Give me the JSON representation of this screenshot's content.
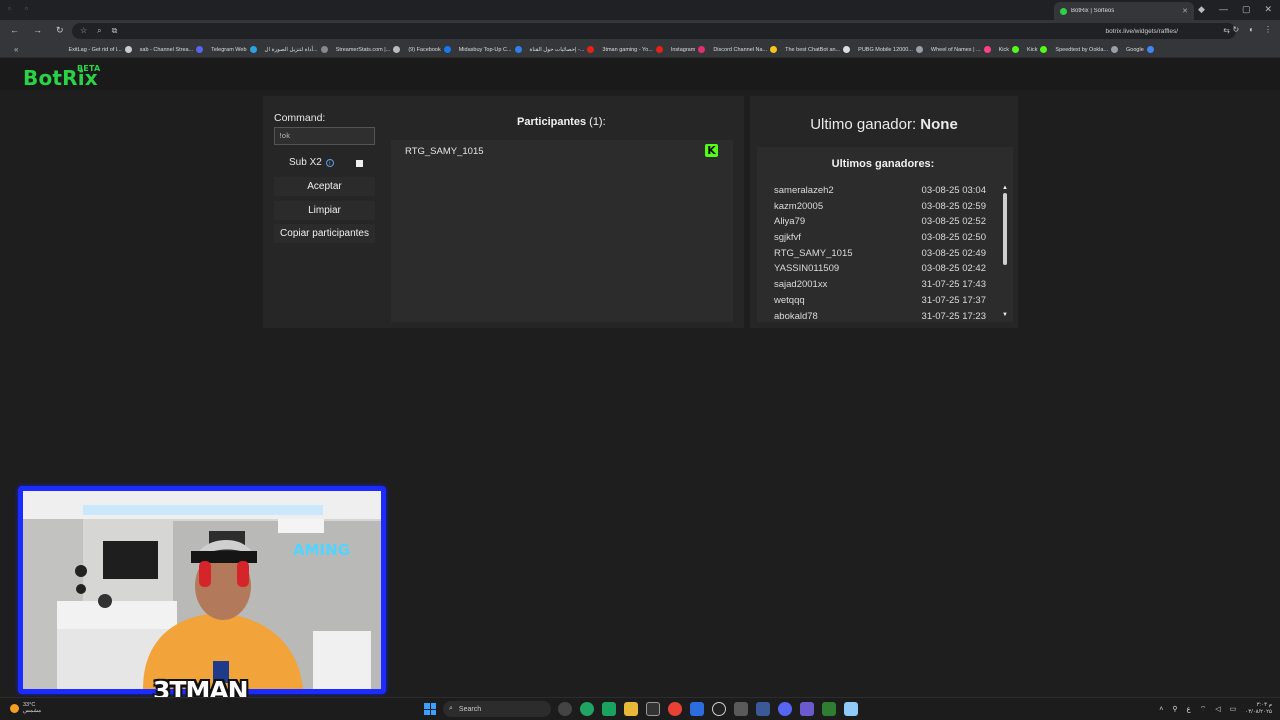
{
  "browser": {
    "tab_title": "BotRix | Sorteos",
    "url": "botrix.live/widgets/raffles/",
    "bookmarks": [
      {
        "label": "ExitLag - Get rid of l...",
        "color": "#cccccc"
      },
      {
        "label": "sab - Channel Strea...",
        "color": "#5865f2"
      },
      {
        "label": "Telegram Web",
        "color": "#2aa3df"
      },
      {
        "label": "أداة لتنزيل الصورة ال...",
        "color": "#888888"
      },
      {
        "label": "StreamerStats.com |...",
        "color": "#bbbbbb"
      },
      {
        "label": "(9) Facebook",
        "color": "#1877f2"
      },
      {
        "label": "Midasbuy Top-Up C...",
        "color": "#2f80ed"
      },
      {
        "label": "إحصائيات حول القناة -...",
        "color": "#e62117"
      },
      {
        "label": "3tman gaming - Yo...",
        "color": "#e62117"
      },
      {
        "label": "Instagram",
        "color": "#e1306c"
      },
      {
        "label": "Discord Channel Na...",
        "color": "#f5c518"
      },
      {
        "label": "The best ChatBot an...",
        "color": "#dddddd"
      },
      {
        "label": "PUBG Mobile 12000...",
        "color": "#9aa0a6"
      },
      {
        "label": "Wheel of Names | ...",
        "color": "#ff4081"
      },
      {
        "label": "Kick",
        "color": "#53fc18"
      },
      {
        "label": "Kick",
        "color": "#53fc18"
      },
      {
        "label": "Speedtest by Ookla...",
        "color": "#9aa0a6"
      },
      {
        "label": "Google",
        "color": "#4285f4"
      }
    ]
  },
  "app": {
    "logo": "BotRix",
    "logo_badge": "BETA",
    "brand_color": "#2bd147"
  },
  "controls": {
    "command_label": "Command:",
    "command_value": "!ok",
    "sub_label": "Sub X2",
    "accept_label": "Aceptar",
    "clear_label": "Limpiar",
    "copy_label": "Copiar participantes"
  },
  "participants": {
    "title": "Participantes",
    "count": "(1):",
    "items": [
      {
        "name": "RTG_SAMY_1015",
        "platform_icon": "K"
      }
    ]
  },
  "winners": {
    "last_label": "Ultimo ganador:",
    "last_value": "None",
    "list_title": "Ultimos ganadores:",
    "items": [
      {
        "name": "sameralazeh2",
        "date": "03-08-25 03:04"
      },
      {
        "name": "kazm20005",
        "date": "03-08-25 02:59"
      },
      {
        "name": "Aliya79",
        "date": "03-08-25 02:52"
      },
      {
        "name": "sgjkfvf",
        "date": "03-08-25 02:50"
      },
      {
        "name": "RTG_SAMY_1015",
        "date": "03-08-25 02:49"
      },
      {
        "name": "YASSIN011509",
        "date": "03-08-25 02:42"
      },
      {
        "name": "sajad2001xx",
        "date": "31-07-25 17:43"
      },
      {
        "name": "wetqqq",
        "date": "31-07-25 17:37"
      },
      {
        "name": "abokald78",
        "date": "31-07-25 17:23"
      }
    ]
  },
  "stream_overlay": {
    "streamer_name": "3TMAN",
    "wall_text": "AMING",
    "frame_color": "#1c2bff"
  },
  "taskbar": {
    "weather_temp": "33°C",
    "weather_desc": "مشمس",
    "search_placeholder": "Search",
    "time": "۳:۰۴ م",
    "date": "۰۳/۰۸/۲۰۲۵",
    "lang": "ع"
  }
}
